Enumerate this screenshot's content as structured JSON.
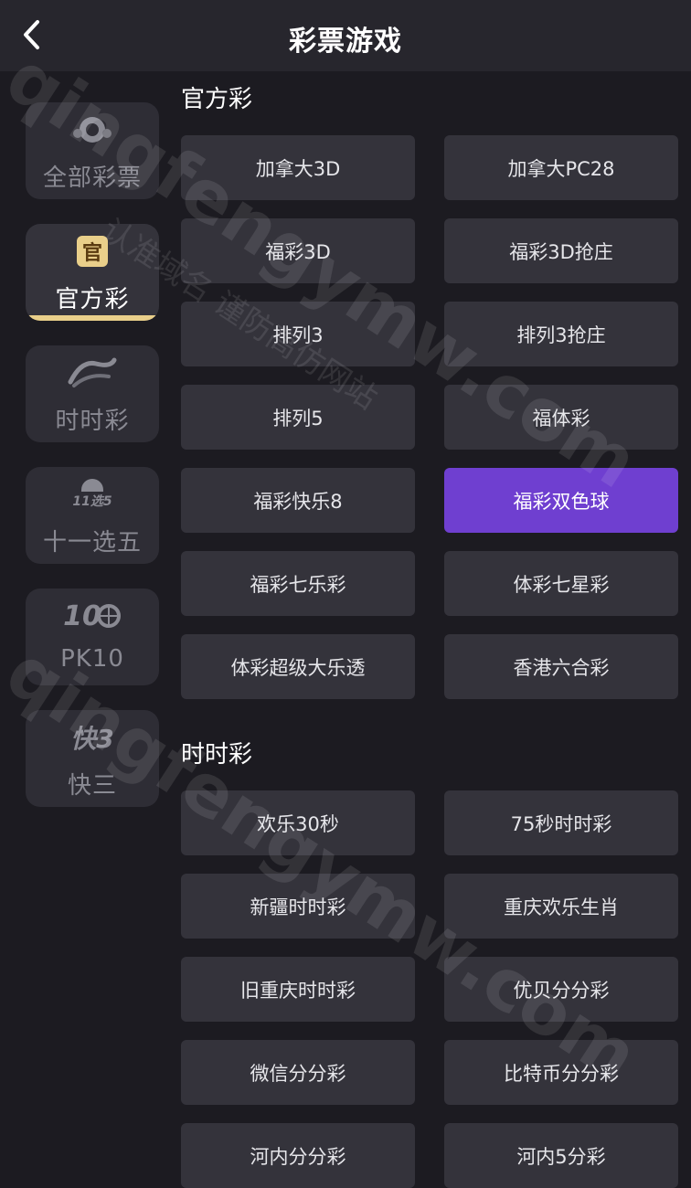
{
  "header": {
    "title": "彩票游戏",
    "back_icon": "chevron-left-icon"
  },
  "sidebar": {
    "items": [
      {
        "label": "全部彩票",
        "icon": "lottery-ball-icon",
        "active": false
      },
      {
        "label": "官方彩",
        "icon": "official-badge-icon",
        "icon_text": "官",
        "active": true
      },
      {
        "label": "时时彩",
        "icon": "ssc-logo-icon",
        "active": false
      },
      {
        "label": "十一选五",
        "icon": "11x5-logo-icon",
        "icon_text": "11选5",
        "active": false
      },
      {
        "label": "PK10",
        "icon": "pk10-wheel-icon",
        "icon_text": "10",
        "active": false
      },
      {
        "label": "快三",
        "icon": "dice-icon",
        "icon_text": "快3",
        "active": false
      }
    ]
  },
  "sections": [
    {
      "title": "官方彩",
      "games": [
        "加拿大3D",
        "加拿大PC28",
        "福彩3D",
        "福彩3D抢庄",
        "排列3",
        "排列3抢庄",
        "排列5",
        "福体彩",
        "福彩快乐8",
        "福彩双色球",
        "福彩七乐彩",
        "体彩七星彩",
        "体彩超级大乐透",
        "香港六合彩"
      ],
      "selected_index": 9
    },
    {
      "title": "时时彩",
      "games": [
        "欢乐30秒",
        "75秒时时彩",
        "新疆时时彩",
        "重庆欢乐生肖",
        "旧重庆时时彩",
        "优贝分分彩",
        "微信分分彩",
        "比特币分分彩",
        "河内分分彩",
        "河内5分彩"
      ]
    }
  ],
  "watermark": {
    "domain": "qingfengymw.com",
    "slogan": "认准域名 谨防高仿网站"
  },
  "colors": {
    "selected": "#6f3fd0",
    "active_underline": "#e9cf8a"
  }
}
